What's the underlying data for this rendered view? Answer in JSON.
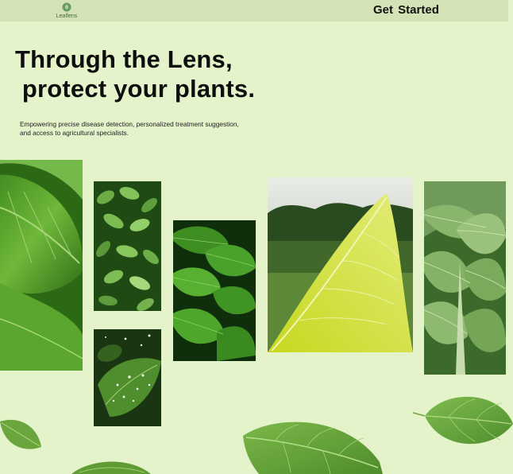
{
  "header": {
    "brand": "Leaflens",
    "cta_label": "Get  Started"
  },
  "hero": {
    "headline": "Through the Lens,\n protect your plants.",
    "subtitle": "Empowering precise disease detection, personalized treatment suggestion, and access to agricultural specialists."
  },
  "colors": {
    "background": "#e4f3c9",
    "topbar": "#d3e3b5",
    "text": "#0e0e0e"
  },
  "gallery": [
    {
      "name": "large-leaf-closeup",
      "icon": "leaf-photo"
    },
    {
      "name": "tea-plant-leaves",
      "icon": "leaf-photo"
    },
    {
      "name": "dewy-leaf",
      "icon": "leaf-photo"
    },
    {
      "name": "wet-green-leaves",
      "icon": "leaf-photo"
    },
    {
      "name": "yellow-leaf-field",
      "icon": "leaf-photo"
    },
    {
      "name": "tobacco-plant",
      "icon": "leaf-photo"
    }
  ]
}
